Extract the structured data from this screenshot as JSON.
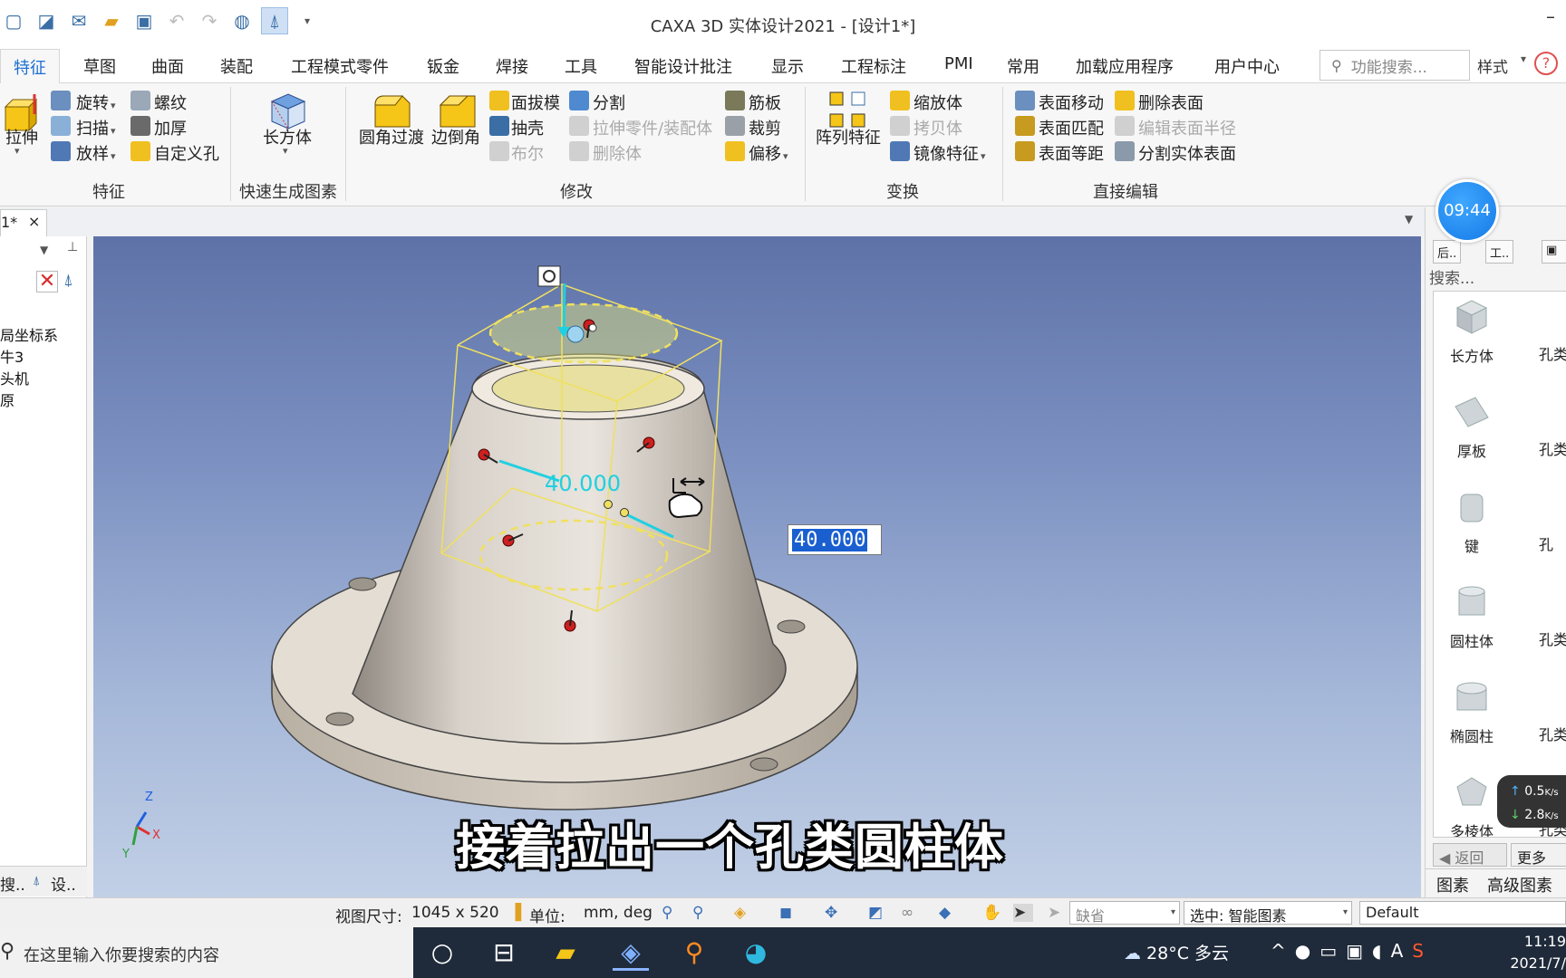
{
  "window": {
    "title": "CAXA 3D 实体设计2021 - [设计1*]",
    "minimize": "–"
  },
  "tabs": [
    "特征",
    "草图",
    "曲面",
    "装配",
    "工程模式零件",
    "钣金",
    "焊接",
    "工具",
    "智能设计批注",
    "显示",
    "工程标注",
    "PMI",
    "常用",
    "加载应用程序",
    "用户中心"
  ],
  "feature_search": {
    "placeholder": "功能搜索..."
  },
  "style_label": "样式",
  "ribbon": {
    "feature": {
      "extrude": "拉伸",
      "revolve": "旋转",
      "sweep": "扫描",
      "loft": "放样",
      "thread": "螺纹",
      "thicken": "加厚",
      "custom_hole": "自定义孔",
      "group": "特征"
    },
    "quick": {
      "box": "长方体",
      "group": "快速生成图素"
    },
    "modify": {
      "fillet": "圆角过渡",
      "chamfer": "边倒角",
      "draft": "面拔模",
      "shell": "抽壳",
      "boolean": "布尔",
      "split": "分割",
      "extrude_part": "拉伸零件/装配体",
      "delete_body": "删除体",
      "rib": "筋板",
      "trim": "裁剪",
      "offset": "偏移",
      "group": "修改"
    },
    "transform": {
      "pattern": "阵列特征",
      "scale": "缩放体",
      "copy": "拷贝体",
      "mirror": "镜像特征",
      "group": "变换"
    },
    "direct_edit": {
      "move_face": "表面移动",
      "match_face": "表面匹配",
      "offset_face": "表面等距",
      "delete_face": "删除表面",
      "edit_radius": "编辑表面半径",
      "split_face": "分割实体表面",
      "group": "直接编辑"
    }
  },
  "doc_tab": {
    "label": "1*",
    "close": "×"
  },
  "tree": {
    "items": [
      "局坐标系",
      "牛3",
      "头机",
      "原"
    ],
    "bottom_tabs": [
      "搜..",
      "设.."
    ]
  },
  "viewport": {
    "dimension_label": "40.000",
    "dimension_input": "40.000",
    "triad": {
      "x": "X",
      "y": "Y",
      "z": "Z"
    }
  },
  "subtitle": "接着拉出一个孔类圆柱体",
  "clock": "09:44",
  "library": {
    "buttons": [
      "后..",
      "工.."
    ],
    "search_label": "搜索...",
    "items": [
      "长方体",
      "厚板",
      "键",
      "圆柱体",
      "椭圆柱",
      "多棱体"
    ],
    "items_col2": [
      "孔类",
      "孔类",
      "孔",
      "孔类",
      "孔类",
      "孔类"
    ],
    "back": "返回",
    "more": "更多",
    "tabs": [
      "图素",
      "高级图素"
    ]
  },
  "netspeed": {
    "up": "0.5",
    "down": "2.8",
    "unit": "K/s"
  },
  "statusbar": {
    "view_size_label": "视图尺寸:",
    "view_size_value": "1045 x  520",
    "unit_label": "单位:",
    "unit_value": "mm, deg",
    "default_combo": "缺省",
    "selection_combo": "选中: 智能图素",
    "render_combo": "Default"
  },
  "taskbar": {
    "search_placeholder": "在这里输入你要搜索的内容",
    "weather_temp": "28°C",
    "weather_desc": "多云",
    "input_method": "A",
    "time": "11:19",
    "date": "2021/7/"
  },
  "colors": {
    "accent": "#1c6fd1",
    "viewport_top": "#5e72a8",
    "viewport_bottom": "#c2d0e6",
    "dimension_cyan": "#20d0e0",
    "bounding_box": "#f0e060"
  }
}
